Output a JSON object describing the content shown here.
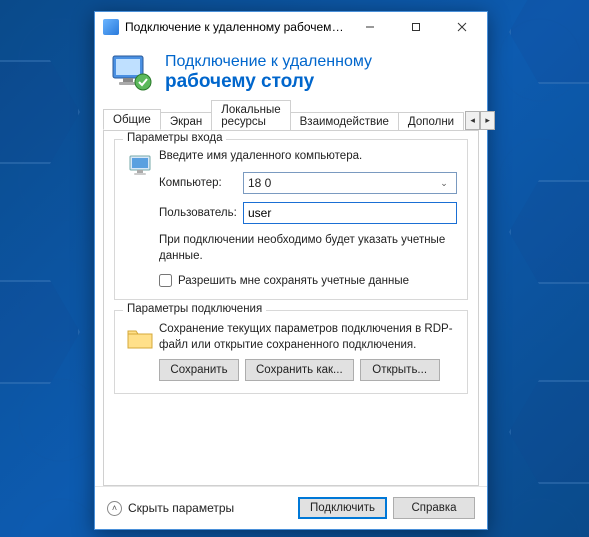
{
  "window": {
    "title": "Подключение к удаленному рабочему с...",
    "header_line1": "Подключение к удаленному",
    "header_line2": "рабочему столу"
  },
  "tabs": {
    "items": [
      "Общие",
      "Экран",
      "Локальные ресурсы",
      "Взаимодействие",
      "Дополни"
    ],
    "active_index": 0
  },
  "login_group": {
    "title": "Параметры входа",
    "intro": "Введите имя удаленного компьютера.",
    "computer_label": "Компьютер:",
    "computer_value": "18             0",
    "user_label": "Пользователь:",
    "user_value": "user",
    "note": "При подключении необходимо будет указать учетные данные.",
    "checkbox_label": "Разрешить мне сохранять учетные данные",
    "checkbox_checked": false
  },
  "conn_group": {
    "title": "Параметры подключения",
    "desc": "Сохранение текущих параметров подключения в RDP-файл или открытие сохраненного подключения.",
    "save_label": "Сохранить",
    "saveas_label": "Сохранить как...",
    "open_label": "Открыть..."
  },
  "footer": {
    "collapse_label": "Скрыть параметры",
    "connect_label": "Подключить",
    "help_label": "Справка"
  }
}
